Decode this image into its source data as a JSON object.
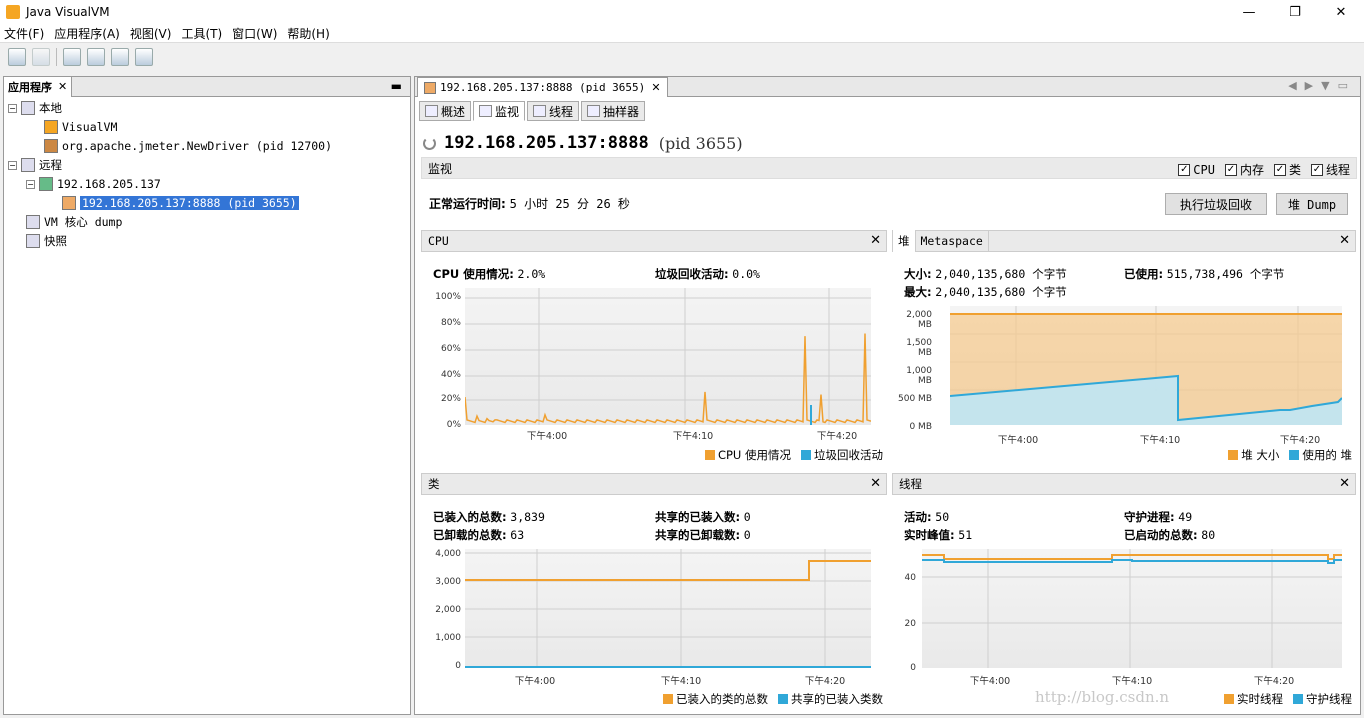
{
  "window": {
    "title": "Java VisualVM"
  },
  "menu": [
    "文件(F)",
    "应用程序(A)",
    "视图(V)",
    "工具(T)",
    "窗口(W)",
    "帮助(H)"
  ],
  "left": {
    "tab": "应用程序",
    "tree": [
      "本地",
      "VisualVM",
      "org.apache.jmeter.NewDriver (pid 12700)",
      "远程",
      "192.168.205.137",
      "192.168.205.137:8888 (pid 3655)",
      "VM 核心 dump",
      "快照"
    ]
  },
  "right": {
    "tab": "192.168.205.137:8888 (pid 3655)",
    "subtabs": [
      "概述",
      "监视",
      "线程",
      "抽样器"
    ],
    "heading": "192.168.205.137:8888",
    "pid": "(pid 3655)",
    "monitor_label": "监视",
    "checks": [
      "CPU",
      "内存",
      "类",
      "线程"
    ],
    "uptime_label": "正常运行时间:",
    "uptime": "5 小时 25 分 26 秒",
    "gc_button": "执行垃圾回收",
    "dump_button": "堆 Dump"
  },
  "cpu": {
    "title": "CPU",
    "usage_label": "CPU 使用情况:",
    "usage": "2.0%",
    "gc_label": "垃圾回收活动:",
    "gc": "0.0%",
    "yticks": [
      "100%",
      "80%",
      "60%",
      "40%",
      "20%",
      "0%"
    ],
    "xticks": [
      "下午4:00",
      "下午4:10",
      "下午4:20"
    ],
    "legend": [
      "CPU 使用情况",
      "垃圾回收活动"
    ]
  },
  "heap": {
    "tab1": "堆",
    "tab2": "Metaspace",
    "size_label": "大小:",
    "size": "2,040,135,680 个字节",
    "used_label": "已使用:",
    "used": "515,738,496 个字节",
    "max_label": "最大:",
    "max": "2,040,135,680 个字节",
    "yticks": [
      "2,000 MB",
      "1,500 MB",
      "1,000 MB",
      "500 MB",
      "0 MB"
    ],
    "xticks": [
      "下午4:00",
      "下午4:10",
      "下午4:20"
    ],
    "legend": [
      "堆 大小",
      "使用的 堆"
    ]
  },
  "classes": {
    "title": "类",
    "loaded_label": "已装入的总数:",
    "loaded": "3,839",
    "unloaded_label": "已卸载的总数:",
    "unloaded": "63",
    "shared_loaded_label": "共享的已装入数:",
    "shared_loaded": "0",
    "shared_unloaded_label": "共享的已卸载数:",
    "shared_unloaded": "0",
    "yticks": [
      "4,000",
      "3,000",
      "2,000",
      "1,000",
      "0"
    ],
    "xticks": [
      "下午4:00",
      "下午4:10",
      "下午4:20"
    ],
    "legend": [
      "已装入的类的总数",
      "共享的已装入类数"
    ]
  },
  "threads": {
    "title": "线程",
    "live_label": "活动:",
    "live": "50",
    "daemon_label": "守护进程:",
    "daemon": "49",
    "peak_label": "实时峰值:",
    "peak": "51",
    "started_label": "已启动的总数:",
    "started": "80",
    "yticks": [
      "40",
      "20",
      "0"
    ],
    "xticks": [
      "下午4:00",
      "下午4:10",
      "下午4:20"
    ],
    "legend": [
      "实时线程",
      "守护线程"
    ]
  },
  "colors": {
    "orange": "#f0a030",
    "blue": "#30a8d8",
    "selection": "#3375d6"
  },
  "watermark": "http://blog.csdn.n"
}
